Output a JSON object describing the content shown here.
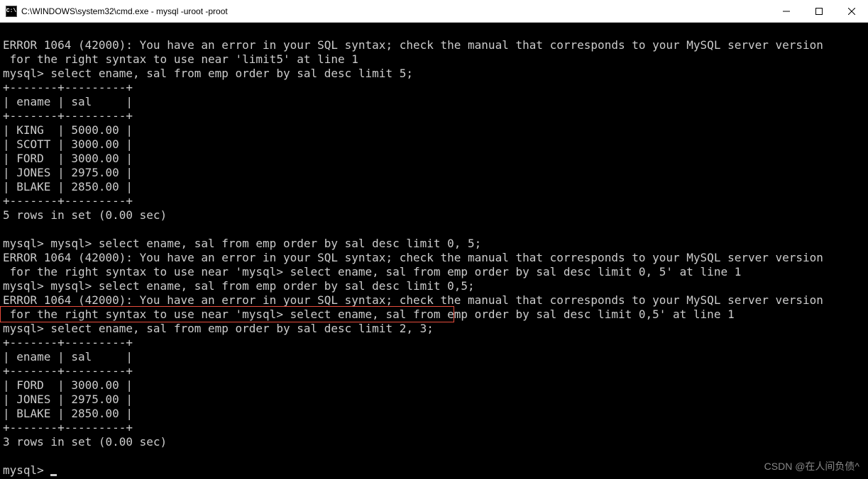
{
  "titlebar": {
    "icon_text": "C:\\",
    "title": "C:\\WINDOWS\\system32\\cmd.exe - mysql  -uroot -proot"
  },
  "terminal": {
    "error1_line1": "ERROR 1064 (42000): You have an error in your SQL syntax; check the manual that corresponds to your MySQL server version",
    "error1_line2": " for the right syntax to use near 'limit5' at line 1",
    "prompt1": "mysql> select ename, sal from emp order by sal desc limit 5;",
    "table1_border": "+-------+---------+",
    "table1_header": "| ename | sal     |",
    "table1_rows": [
      "| KING  | 5000.00 |",
      "| SCOTT | 3000.00 |",
      "| FORD  | 3000.00 |",
      "| JONES | 2975.00 |",
      "| BLAKE | 2850.00 |"
    ],
    "result1": "5 rows in set (0.00 sec)",
    "prompt2": "mysql> mysql> select ename, sal from emp order by sal desc limit 0, 5;",
    "error2_line1": "ERROR 1064 (42000): You have an error in your SQL syntax; check the manual that corresponds to your MySQL server version",
    "error2_line2": " for the right syntax to use near 'mysql> select ename, sal from emp order by sal desc limit 0, 5' at line 1",
    "prompt3": "mysql> mysql> select ename, sal from emp order by sal desc limit 0,5;",
    "error3_line1": "ERROR 1064 (42000): You have an error in your SQL syntax; check the manual that corresponds to your MySQL server version",
    "error3_line2": " for the right syntax to use near 'mysql> select ename, sal from emp order by sal desc limit 0,5' at line 1",
    "prompt4": "mysql> select ename, sal from emp order by sal desc limit 2, 3;",
    "table2_border": "+-------+---------+",
    "table2_header": "| ename | sal     |",
    "table2_rows": [
      "| FORD  | 3000.00 |",
      "| JONES | 2975.00 |",
      "| BLAKE | 2850.00 |"
    ],
    "result2": "3 rows in set (0.00 sec)",
    "prompt5": "mysql> "
  },
  "watermark": "CSDN @在人间负债^"
}
